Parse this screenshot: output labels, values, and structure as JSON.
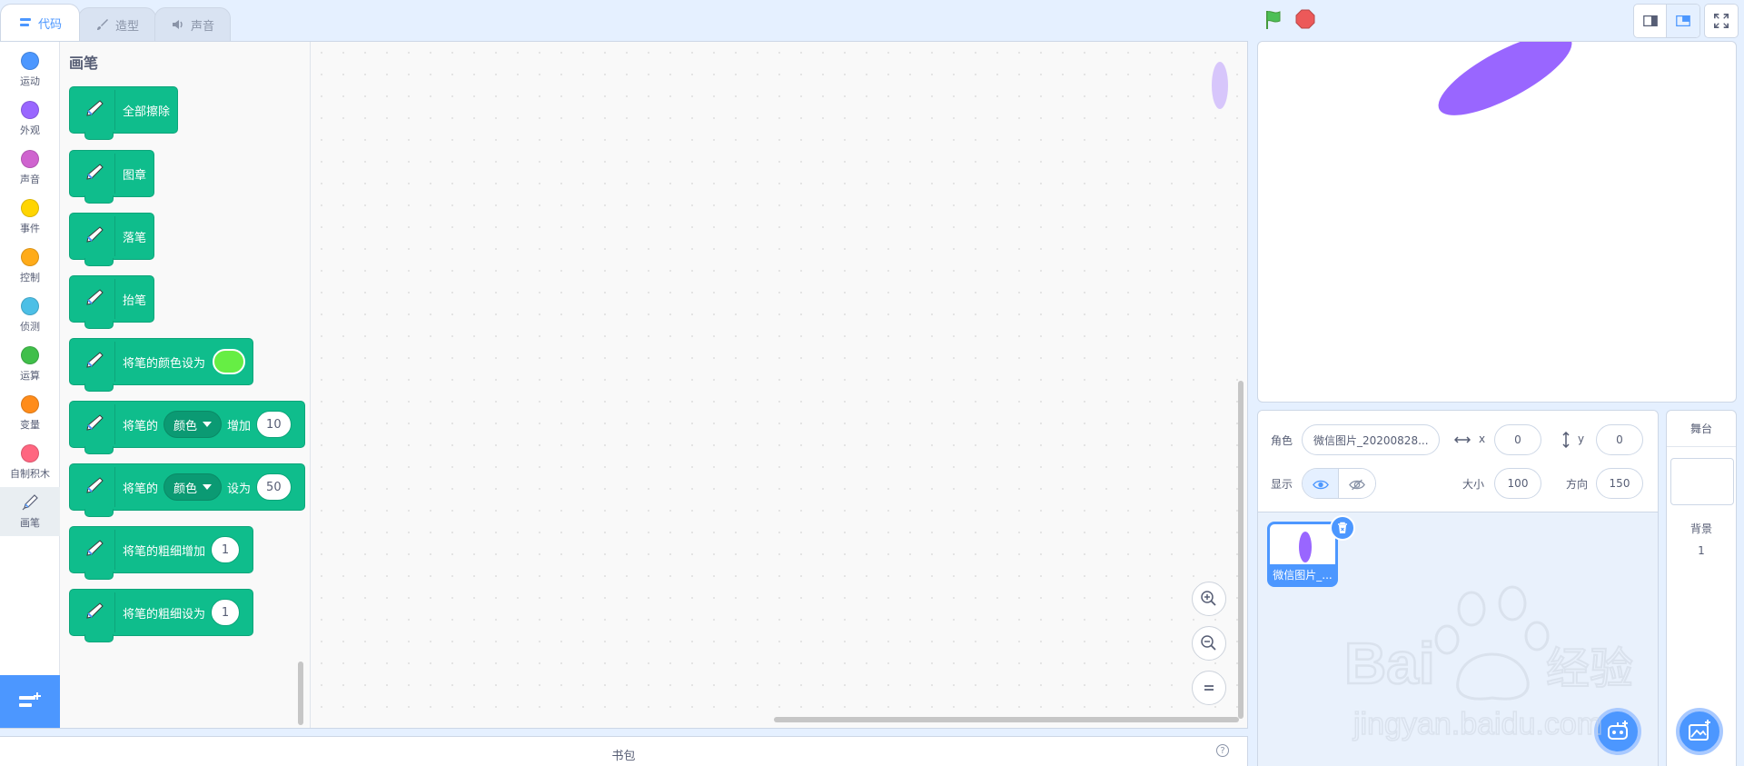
{
  "tabs": [
    {
      "label": "代码",
      "icon": "code-icon",
      "active": true
    },
    {
      "label": "造型",
      "icon": "brush-icon",
      "active": false
    },
    {
      "label": "声音",
      "icon": "speaker-icon",
      "active": false
    }
  ],
  "categories": [
    {
      "label": "运动",
      "color": "#4c97ff"
    },
    {
      "label": "外观",
      "color": "#9966ff"
    },
    {
      "label": "声音",
      "color": "#cf63cf"
    },
    {
      "label": "事件",
      "color": "#ffd500"
    },
    {
      "label": "控制",
      "color": "#ffab19"
    },
    {
      "label": "侦测",
      "color": "#4cbfe6"
    },
    {
      "label": "运算",
      "color": "#40bf4a"
    },
    {
      "label": "变量",
      "color": "#ff8c1a"
    },
    {
      "label": "自制积木",
      "color": "#ff6680"
    },
    {
      "label": "画笔",
      "color": "#0fbd8c",
      "icon": "pen-icon",
      "selected": true
    }
  ],
  "palette": {
    "title": "画笔",
    "blocks": {
      "clear": "全部擦除",
      "stamp": "图章",
      "pen_down": "落笔",
      "pen_up": "抬笔",
      "set_color": "将笔的颜色设为",
      "change_param_prefix": "将笔的",
      "change_param_dropdown": "颜色",
      "change_param_mid": "增加",
      "change_param_value": "10",
      "set_param_prefix": "将笔的",
      "set_param_dropdown": "颜色",
      "set_param_mid": "设为",
      "set_param_value": "50",
      "change_size": "将笔的粗细增加",
      "change_size_value": "1",
      "set_size": "将笔的粗细设为",
      "set_size_value": "1"
    }
  },
  "backpack": {
    "label": "书包",
    "help": "?"
  },
  "sprite_info": {
    "sprite_label": "角色",
    "sprite_name": "微信图片_20200828...",
    "x_label": "x",
    "x_value": "0",
    "y_label": "y",
    "y_value": "0",
    "show_label": "显示",
    "size_label": "大小",
    "size_value": "100",
    "direction_label": "方向",
    "direction_value": "150"
  },
  "sprite_tile": {
    "name": "微信图片_..."
  },
  "stage_pane": {
    "header": "舞台",
    "backdrop_label": "背景",
    "backdrop_count": "1"
  },
  "colors": {
    "accent": "#4c97ff",
    "pen_green": "#0fbd8c",
    "sprite_purple": "#9966ff",
    "pen_color_swatch": "#66ee44"
  }
}
